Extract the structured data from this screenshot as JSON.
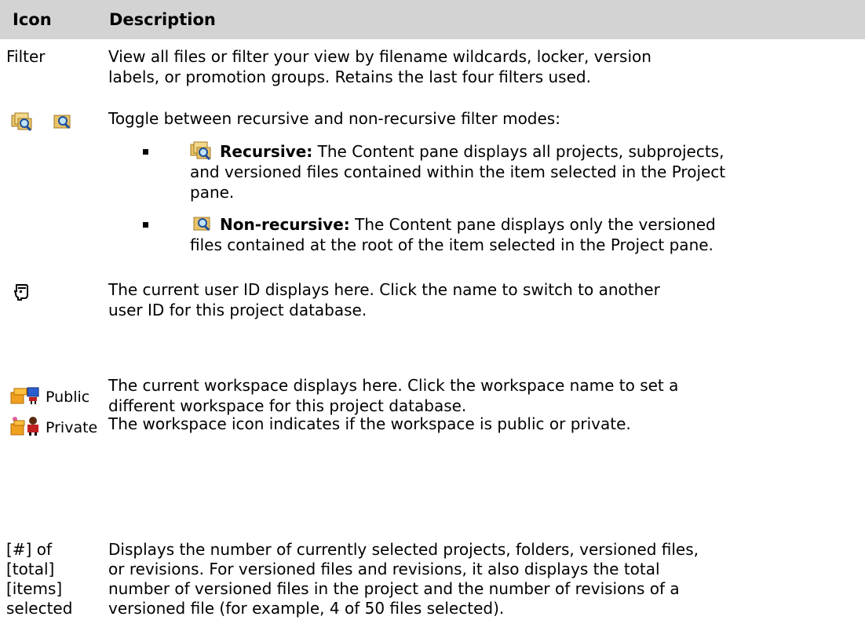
{
  "table": {
    "headers": {
      "icon": "Icon",
      "description": "Description"
    },
    "filter_row": {
      "icon_label": "Filter",
      "lines": [
        "View all files or filter your view by filename wildcards, locker, version",
        "labels, or promotion groups. Retains the last four filters used."
      ]
    },
    "recursive_row": {
      "intro": "Toggle between recursive and non-recursive filter modes:",
      "items": [
        {
          "label": "Recursive:",
          "icon": "recursive-folder-search-icon",
          "lines": [
            " The Content pane displays all projects, subprojects,",
            "and versioned files contained within the item selected in the Project",
            "pane."
          ]
        },
        {
          "label": "Non-recursive:",
          "icon": "nonrecursive-folder-search-icon",
          "lines": [
            " The Content pane displays only the versioned",
            "files contained at the root of the item selected in the Project pane."
          ]
        }
      ]
    },
    "user_row": {
      "icon": "user-head-icon",
      "lines": [
        "The current user ID displays here. Click the name to switch to another",
        "user ID for this project database."
      ]
    },
    "workspace_row": {
      "public_label": "Public",
      "private_label": "Private",
      "lines": [
        "The current workspace displays here. Click the workspace name to set a",
        "different workspace for this project database.",
        "The workspace icon indicates if the workspace is public or private."
      ]
    },
    "selected_row": {
      "icon_lines": [
        "[#] of",
        "[total]",
        "[items]",
        "selected"
      ],
      "lines": [
        "Displays the number of currently selected projects, folders, versioned files,",
        "or revisions. For versioned files and revisions, it also displays the total",
        "number of versioned files in the project and the number of revisions of a",
        "versioned file (for example, 4 of 50 files selected)."
      ]
    }
  }
}
